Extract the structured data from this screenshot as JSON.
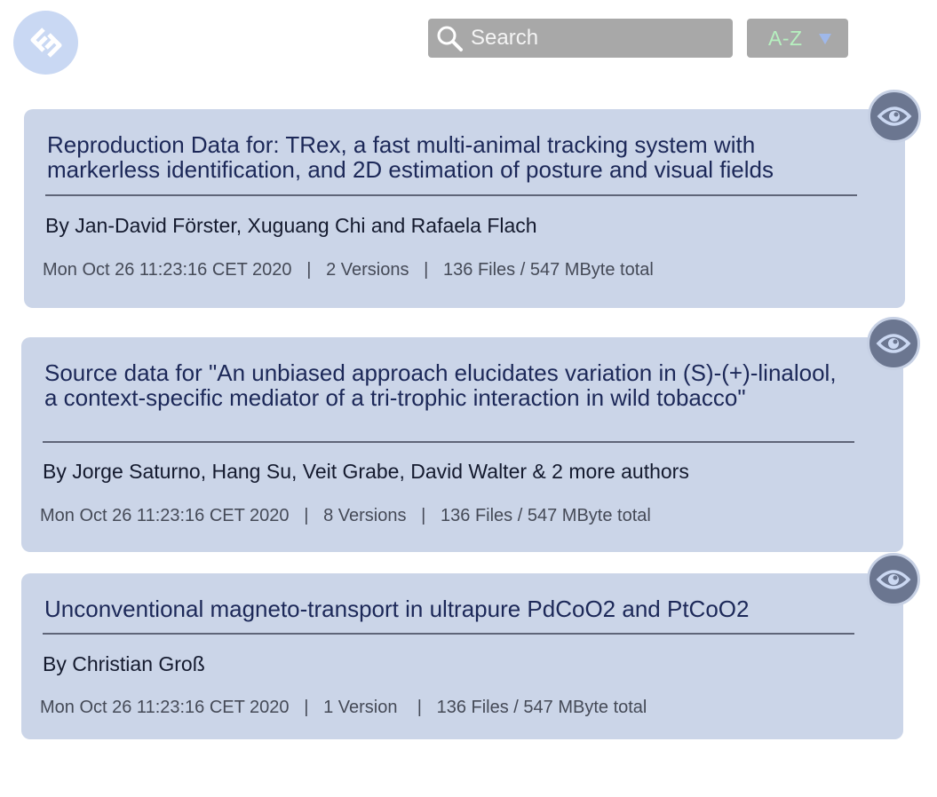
{
  "header": {
    "search": {
      "placeholder": "Search",
      "value": ""
    },
    "sort": {
      "label": "A-Z"
    }
  },
  "colors": {
    "card_bg": "#cbd5e8",
    "title_text": "#1c2858",
    "logo_bg": "#c9d8f3",
    "eye_button_bg": "#6b7690",
    "search_bg": "#a8a8a8"
  },
  "datasets": [
    {
      "title": "Reproduction Data for: TRex, a fast multi-animal tracking system with markerless identification, and 2D estimation of posture and visual fields",
      "authors": "By Jan-David Förster, Xuguang Chi and Rafaela Flach",
      "date": "Mon Oct 26 11:23:16 CET 2020",
      "versions": "2 Versions",
      "files": "136 Files / 547 MByte total"
    },
    {
      "title": "Source data for \"An unbiased approach elucidates variation in (S)-(+)-linalool, a context-specific mediator of a tri-trophic interaction in wild tobacco\"",
      "authors": "By Jorge Saturno, Hang Su, Veit Grabe, David Walter & 2 more authors",
      "date": "Mon Oct 26 11:23:16 CET 2020",
      "versions": "8 Versions",
      "files": "136 Files / 547 MByte total"
    },
    {
      "title": "Unconventional magneto-transport in ultrapure PdCoO2 and PtCoO2",
      "authors": "By Christian Groß",
      "date": "Mon Oct 26 11:23:16 CET 2020",
      "versions": "1 Version",
      "files": "136 Files / 547 MByte total"
    }
  ]
}
